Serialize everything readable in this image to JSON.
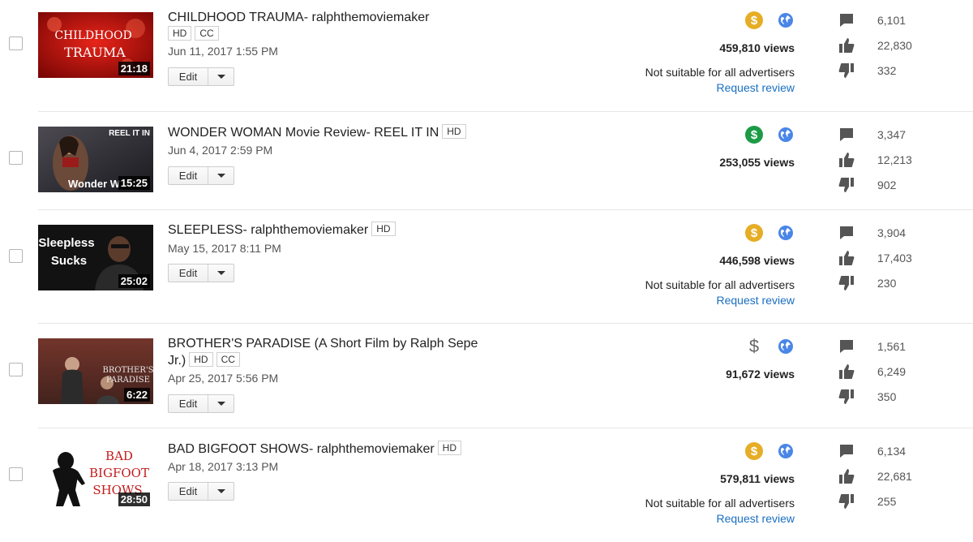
{
  "videos": [
    {
      "title": "CHILDHOOD TRAUMA- ralphthemoviemaker",
      "title_line2": "",
      "badges": [
        "HD",
        "CC"
      ],
      "date": "Jun 11, 2017 1:55 PM",
      "duration": "21:18",
      "thumb_text": [
        "CHILDHOOD",
        "TRAUMA"
      ],
      "edit_label": "Edit",
      "monetization_icon": "gold-dollar-icon",
      "views": "459,810 views",
      "ad_status": "Not suitable for all advertisers",
      "review_link": "Request review",
      "comments": "6,101",
      "likes": "22,830",
      "dislikes": "332"
    },
    {
      "title": "WONDER WOMAN Movie Review- REEL IT IN",
      "title_line2": "",
      "badges": [
        "HD"
      ],
      "date": "Jun 4, 2017 2:59 PM",
      "duration": "15:25",
      "thumb_text": [
        "REEL IT IN",
        "Wonder W"
      ],
      "edit_label": "Edit",
      "monetization_icon": "green-dollar-icon",
      "views": "253,055 views",
      "ad_status": "",
      "review_link": "",
      "comments": "3,347",
      "likes": "12,213",
      "dislikes": "902"
    },
    {
      "title": "SLEEPLESS- ralphthemoviemaker",
      "title_line2": "",
      "badges": [
        "HD"
      ],
      "date": "May 15, 2017 8:11 PM",
      "duration": "25:02",
      "thumb_text": [
        "Sleepless",
        "Sucks"
      ],
      "edit_label": "Edit",
      "monetization_icon": "gold-dollar-icon",
      "views": "446,598 views",
      "ad_status": "Not suitable for all advertisers",
      "review_link": "Request review",
      "comments": "3,904",
      "likes": "17,403",
      "dislikes": "230"
    },
    {
      "title": "BROTHER'S PARADISE (A Short Film by Ralph Sepe",
      "title_line2": "Jr.)",
      "badges": [
        "HD",
        "CC"
      ],
      "date": "Apr 25, 2017 5:56 PM",
      "duration": "6:22",
      "thumb_text": [
        "BROTHER'S",
        "PARADISE"
      ],
      "edit_label": "Edit",
      "monetization_icon": "grey-dollar-icon",
      "views": "91,672 views",
      "ad_status": "",
      "review_link": "",
      "comments": "1,561",
      "likes": "6,249",
      "dislikes": "350"
    },
    {
      "title": "BAD BIGFOOT SHOWS- ralphthemoviemaker",
      "title_line2": "",
      "badges": [
        "HD"
      ],
      "date": "Apr 18, 2017 3:13 PM",
      "duration": "28:50",
      "thumb_text": [
        "BAD",
        "BIGFOOT",
        "SHOWS"
      ],
      "edit_label": "Edit",
      "monetization_icon": "gold-dollar-icon",
      "views": "579,811 views",
      "ad_status": "Not suitable for all advertisers",
      "review_link": "Request review",
      "comments": "6,134",
      "likes": "22,681",
      "dislikes": "255"
    }
  ],
  "money_glyph": "$",
  "colors": {
    "gold": "#e6ad25",
    "green": "#1c9b47",
    "link": "#1a6fc1",
    "globe": "#4a86e8"
  }
}
